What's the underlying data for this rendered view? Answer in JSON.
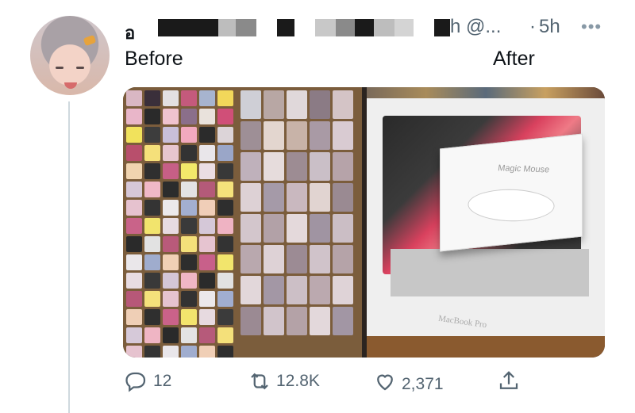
{
  "tweet": {
    "author": {
      "name_visible": "อ",
      "handle_suffix_visible": "h @...",
      "time": "5h"
    },
    "more_icon": "more-horizontal-icon",
    "text_left": "Before",
    "text_right": "After"
  },
  "media": {
    "left_image_watermark": "",
    "right_box_top_label": "Magic Mouse",
    "right_box_bottom_label": "MacBook Pro"
  },
  "actions": {
    "reply_count": "12",
    "retweet_count": "12.8K",
    "like_count": "2,371"
  },
  "colors": {
    "secondary_text": "#536471",
    "thread_line": "#cfd9de"
  }
}
